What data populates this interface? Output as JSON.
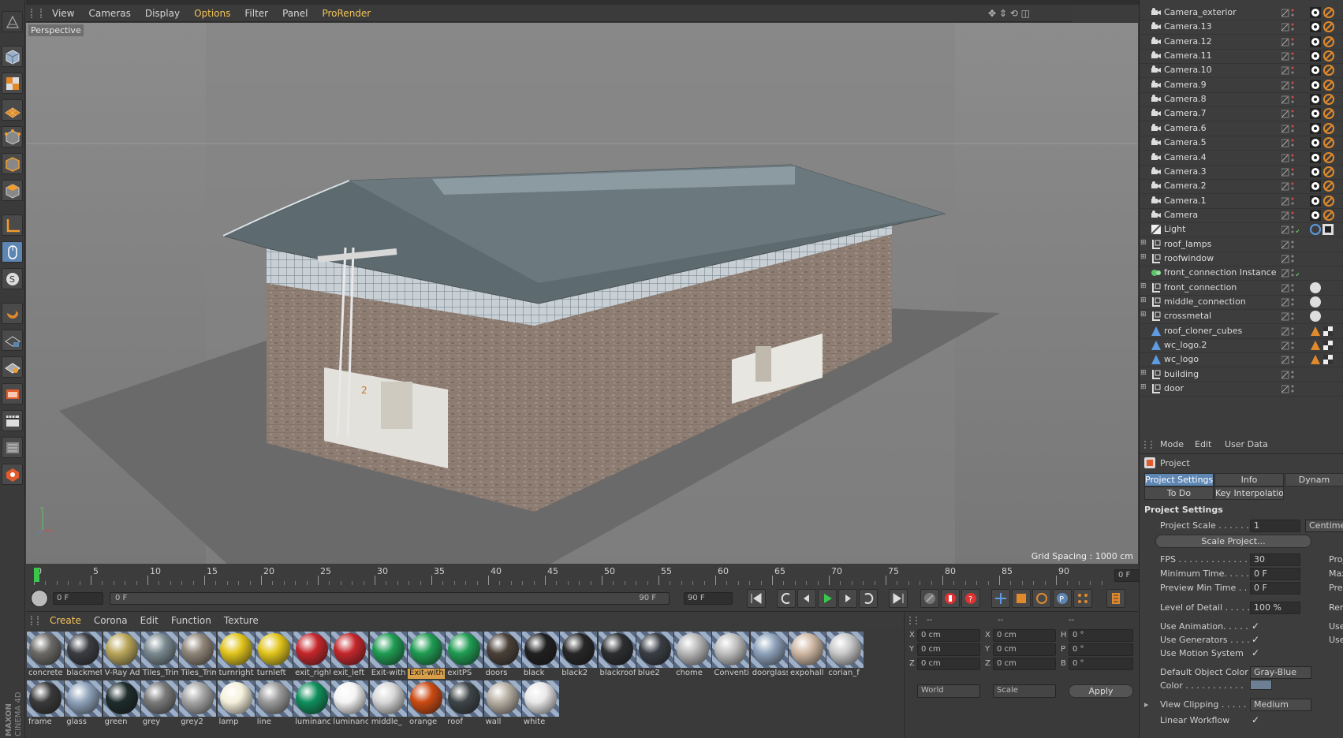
{
  "viewport": {
    "menu": [
      "View",
      "Cameras",
      "Display",
      "Options",
      "Filter",
      "Panel",
      "ProRender"
    ],
    "label": "Perspective",
    "grid_spacing": "Grid Spacing : 1000 cm"
  },
  "timeline": {
    "ticks": [
      "0",
      "5",
      "10",
      "15",
      "20",
      "25",
      "30",
      "35",
      "40",
      "45",
      "50",
      "55",
      "60",
      "65",
      "70",
      "75",
      "80",
      "85",
      "90"
    ],
    "current_frame": "0 F",
    "start_frame": "0 F",
    "range_start": "0 F",
    "range_end": "90 F",
    "end_frame": "90 F"
  },
  "materials": {
    "menu": [
      "Create",
      "Corona",
      "Edit",
      "Function",
      "Texture"
    ],
    "items": [
      {
        "label": "concrete",
        "color": "#6b6a66"
      },
      {
        "label": "blackmetal",
        "color": "#3b3d42"
      },
      {
        "label": "V-Ray Adv",
        "color": "#b9a65a"
      },
      {
        "label": "Tiles_Trim",
        "color": "#7a8a90"
      },
      {
        "label": "Tiles_Trim",
        "color": "#8f8478"
      },
      {
        "label": "turnright",
        "color": "#e2c51c"
      },
      {
        "label": "turnleft",
        "color": "#e2c51c"
      },
      {
        "label": "exit_right",
        "color": "#c4262b"
      },
      {
        "label": "exit_left",
        "color": "#c4262b"
      },
      {
        "label": "Exit-with",
        "color": "#1f9c52"
      },
      {
        "label": "Exit-with",
        "color": "#1f9c52"
      },
      {
        "label": "exitPS",
        "color": "#1f9c52"
      },
      {
        "label": "doors",
        "color": "#4a4038"
      },
      {
        "label": "black",
        "color": "#202020"
      },
      {
        "label": "black2",
        "color": "#262626"
      },
      {
        "label": "blackroof",
        "color": "#2c2e30"
      },
      {
        "label": "blue2",
        "color": "#3a3e44"
      },
      {
        "label": "chome",
        "color": "#b8b8b8"
      },
      {
        "label": "Convention",
        "color": "#c0c0c0"
      },
      {
        "label": "doorglass",
        "color": "#8fa3bb"
      },
      {
        "label": "expohall",
        "color": "#cfb8a4"
      },
      {
        "label": "corian_f",
        "color": "#c9c9c9"
      },
      {
        "label": "frame",
        "color": "#3a3a3a"
      },
      {
        "label": "glass",
        "color": "#8fa3bb"
      },
      {
        "label": "green",
        "color": "#1d2c2a"
      },
      {
        "label": "grey",
        "color": "#7a7a7a"
      },
      {
        "label": "grey2",
        "color": "#a6a6a6"
      },
      {
        "label": "lamp",
        "color": "#f5f1dc"
      },
      {
        "label": "line",
        "color": "#9a9a9a"
      },
      {
        "label": "luminance",
        "color": "#0f8f5a"
      },
      {
        "label": "luminance",
        "color": "#f4f4f4"
      },
      {
        "label": "middle_",
        "color": "#d8d8d8"
      },
      {
        "label": "orange",
        "color": "#cc4a12"
      },
      {
        "label": "roof",
        "color": "#3e4548"
      },
      {
        "label": "wall",
        "color": "#b7afa3"
      },
      {
        "label": "white",
        "color": "#e8e8e8"
      }
    ],
    "selected_index": 10
  },
  "coords": {
    "headers": [
      "--",
      "--",
      "--"
    ],
    "rows": [
      {
        "a": "X",
        "av": "0 cm",
        "b": "X",
        "bv": "0 cm",
        "c": "H",
        "cv": "0 °"
      },
      {
        "a": "Y",
        "av": "0 cm",
        "b": "Y",
        "bv": "0 cm",
        "c": "P",
        "cv": "0 °"
      },
      {
        "a": "Z",
        "av": "0 cm",
        "b": "Z",
        "bv": "0 cm",
        "c": "B",
        "cv": "0 °"
      }
    ],
    "mode1": "World",
    "mode2": "Scale",
    "apply": "Apply"
  },
  "objects": [
    {
      "label": "Camera_exterior",
      "type": "camera"
    },
    {
      "label": "Camera.13",
      "type": "camera"
    },
    {
      "label": "Camera.12",
      "type": "camera"
    },
    {
      "label": "Camera.11",
      "type": "camera"
    },
    {
      "label": "Camera.10",
      "type": "camera"
    },
    {
      "label": "Camera.9",
      "type": "camera"
    },
    {
      "label": "Camera.8",
      "type": "camera"
    },
    {
      "label": "Camera.7",
      "type": "camera"
    },
    {
      "label": "Camera.6",
      "type": "camera"
    },
    {
      "label": "Camera.5",
      "type": "camera"
    },
    {
      "label": "Camera.4",
      "type": "camera"
    },
    {
      "label": "Camera.3",
      "type": "camera"
    },
    {
      "label": "Camera.2",
      "type": "camera"
    },
    {
      "label": "Camera.1",
      "type": "camera"
    },
    {
      "label": "Camera",
      "type": "camera"
    },
    {
      "label": "Light",
      "type": "light"
    },
    {
      "label": "roof_lamps",
      "type": "null"
    },
    {
      "label": "roofwindow",
      "type": "null"
    },
    {
      "label": "front_connection Instance",
      "type": "instance"
    },
    {
      "label": "front_connection",
      "type": "null"
    },
    {
      "label": "middle_connection",
      "type": "null"
    },
    {
      "label": "crossmetal",
      "type": "null"
    },
    {
      "label": "roof_cloner_cubes",
      "type": "poly"
    },
    {
      "label": "wc_logo.2",
      "type": "poly"
    },
    {
      "label": "wc_logo",
      "type": "poly"
    },
    {
      "label": "building",
      "type": "null"
    },
    {
      "label": "door",
      "type": "null"
    }
  ],
  "attributes": {
    "menu": [
      "Mode",
      "Edit",
      "User Data"
    ],
    "object": "Project",
    "tabs": [
      "Project Settings",
      "Info",
      "Dynam",
      "To Do",
      "Key Interpolation"
    ],
    "section": "Project Settings",
    "project_scale_label": "Project Scale . . . . . .",
    "project_scale_value": "1",
    "project_scale_unit": "Centime",
    "scale_project_btn": "Scale Project...",
    "fps_label": "FPS . . . . . . . . . . . . . .",
    "fps_value": "30",
    "fps_right": "Proj",
    "min_time_label": "Minimum Time. . . . . .",
    "min_time_value": "0 F",
    "min_time_right": "Max",
    "prev_min_label": "Preview Min Time . . .",
    "prev_min_value": "0 F",
    "prev_min_right": "Prev",
    "lod_label": "Level of Detail . . . . .",
    "lod_value": "100 %",
    "lod_right": "Ren",
    "use_anim": "Use Animation. . . . .",
    "use_anim_right": "Use",
    "use_gen": "Use Generators . . . .",
    "use_gen_right": "Use",
    "use_motion": "Use Motion System",
    "def_color_label": "Default Object Color",
    "def_color_value": "Gray-Blue",
    "color_label": "Color . . . . . . . . . . .",
    "view_clip_label": "View Clipping . . . . .",
    "view_clip_value": "Medium",
    "linear_label": "Linear Workflow"
  },
  "brand": {
    "line1": "MAXON",
    "line2": "CINEMA 4D"
  }
}
